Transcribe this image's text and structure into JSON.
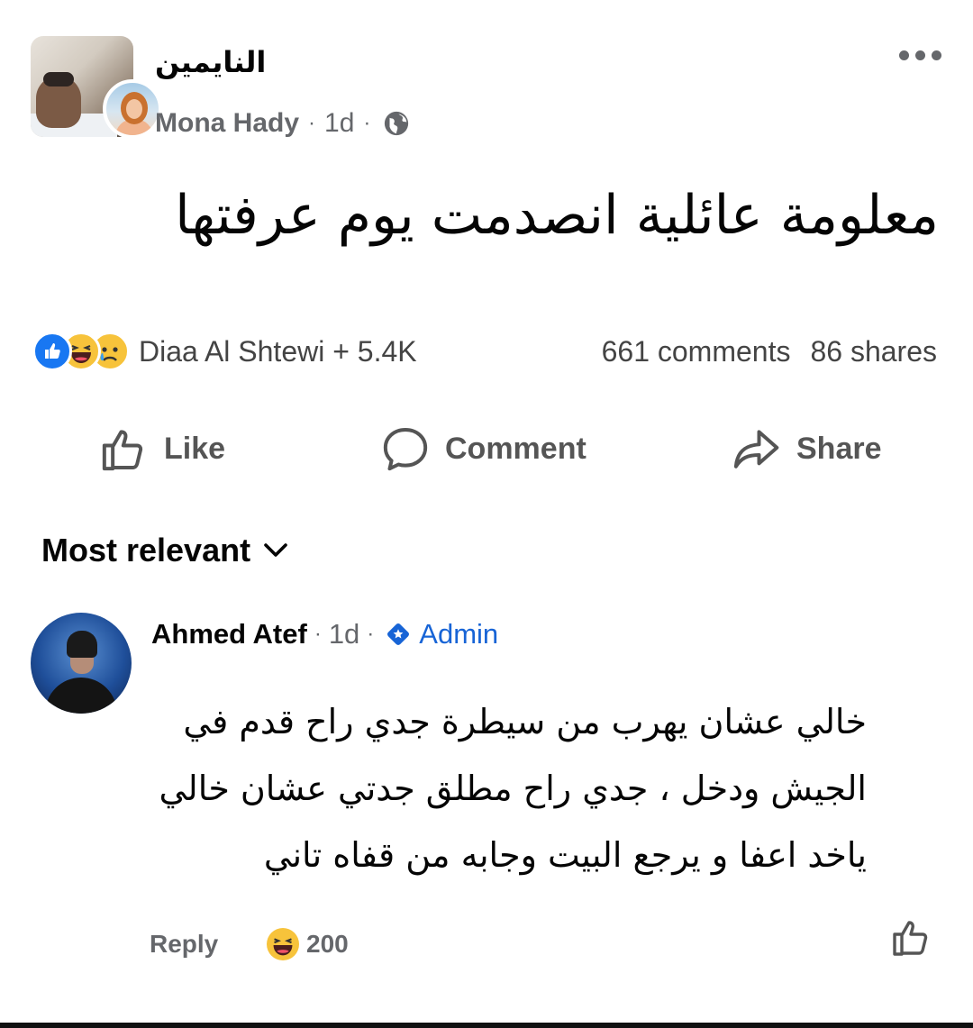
{
  "post": {
    "group_name": "النايمين",
    "author": "Mona Hady",
    "time": "1d",
    "separator": "·",
    "text": "معلومة عائلية انصدمت يوم عرفتها"
  },
  "icons": {
    "more": "more-options-icon",
    "privacy": "globe-icon",
    "reactions": [
      "like-reaction-icon",
      "haha-reaction-icon",
      "sad-reaction-icon"
    ]
  },
  "stats": {
    "reactors": "Diaa Al Shtewi + 5.4K",
    "comments": "661 comments",
    "shares": "86 shares"
  },
  "actions": {
    "like": "Like",
    "comment": "Comment",
    "share": "Share"
  },
  "sort": {
    "label": "Most relevant"
  },
  "comment": {
    "author": "Ahmed Atef",
    "time": "1d",
    "badge": "Admin",
    "lines": [
      "خالي عشان يهرب من سيطرة جدي راح قدم في",
      "الجيش ودخل ، جدي راح مطلق جدتي عشان خالي",
      "ياخد اعفا و يرجع البيت وجابه من قفاه تاني"
    ],
    "reply_label": "Reply",
    "reaction_count": "200"
  },
  "colors": {
    "accent": "#1877f2",
    "admin_blue": "#1764d6",
    "secondary_text": "#65676b",
    "reaction_yellow": "#f7c33b"
  }
}
